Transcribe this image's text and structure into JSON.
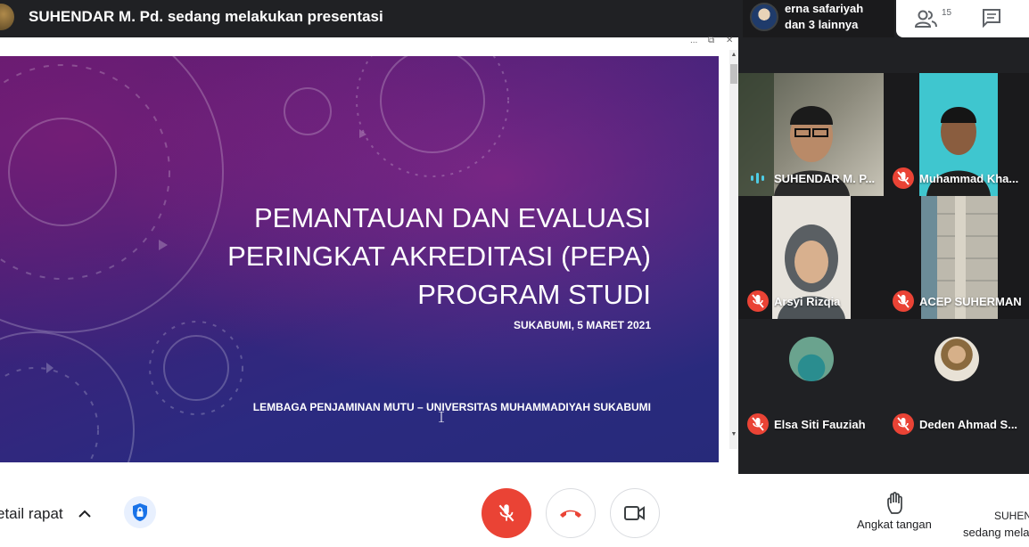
{
  "header": {
    "presenting_title": "SUHENDAR M. Pd. sedang melakukan presentasi",
    "participants_chip": {
      "line1": "erna safariyah",
      "line2": "dan 3 lainnya"
    },
    "people_count": "15",
    "people_icon": "people-icon",
    "chat_icon": "chat-icon"
  },
  "slide": {
    "title_lines": [
      "PEMANTAUAN DAN EVALUASI",
      "PERINGKAT AKREDITASI (PEPA)",
      "PROGRAM STUDI"
    ],
    "date": "SUKABUMI, 5 MARET 2021",
    "organization": "LEMBAGA PENJAMINAN MUTU – UNIVERSITAS MUHAMMADIYAH SUKABUMI",
    "window_controls": [
      "...",
      "⧉",
      "✕"
    ]
  },
  "participants": [
    {
      "name": "SUHENDAR M. P...",
      "status": "speaking"
    },
    {
      "name": "Muhammad Kha...",
      "status": "muted"
    },
    {
      "name": "Arsyi Rizqia",
      "status": "muted"
    },
    {
      "name": "ACEP SUHERMAN",
      "status": "muted"
    },
    {
      "name": "Elsa Siti Fauziah",
      "status": "muted"
    },
    {
      "name": "Deden Ahmad S...",
      "status": "muted"
    }
  ],
  "footer": {
    "meeting_details": "etail rapat",
    "raise_hand_label": "Angkat tangan",
    "presenter_line1": "SUHEN",
    "presenter_line2": "sedang mela"
  },
  "colors": {
    "mute_red": "#ea4335",
    "bar_dark": "#202124",
    "accent_blue": "#1a73e8"
  }
}
